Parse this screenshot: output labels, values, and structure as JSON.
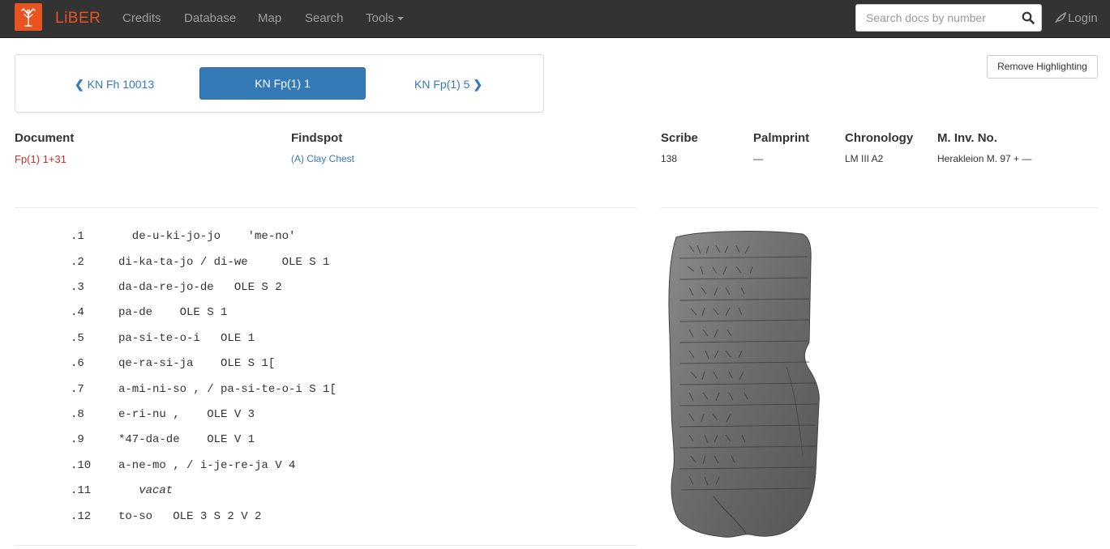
{
  "nav": {
    "brand": "LiBER",
    "items": [
      "Credits",
      "Database",
      "Map",
      "Search",
      "Tools"
    ],
    "search_placeholder": "Search docs by number",
    "login": "Login"
  },
  "pager": {
    "prev": "KN Fh 10013",
    "current": "KN Fp(1) 1",
    "next": "KN Fp(1) 5"
  },
  "remove_highlighting": "Remove Highlighting",
  "meta": {
    "document_label": "Document",
    "document_value": "Fp(1) 1+31",
    "findspot_label": "Findspot",
    "findspot_value": "(A) Clay Chest",
    "scribe_label": "Scribe",
    "scribe_value": "138",
    "palmprint_label": "Palmprint",
    "palmprint_value": "—",
    "chronology_label": "Chronology",
    "chronology_value": "LM III A2",
    "inv_label": "M. Inv. No.",
    "inv_value": "Herakleion M. 97 + —"
  },
  "lines": [
    {
      "num": ".1",
      "text": "  de-u-ki-jo-jo    'me-no'"
    },
    {
      "num": ".2",
      "text": "di-ka-ta-jo / di-we     OLE S 1"
    },
    {
      "num": ".3",
      "text": "da-da-re-jo-de   OLE S 2"
    },
    {
      "num": ".4",
      "text": "pa-de    OLE S 1"
    },
    {
      "num": ".5",
      "text": "pa-si-te-o-i   OLE 1"
    },
    {
      "num": ".6",
      "text": "qe-ra-si-ja    OLE S 1["
    },
    {
      "num": ".7",
      "text": "a-mi-ni-so , / pa-si-te-o-i S 1["
    },
    {
      "num": ".8",
      "text": "e-ri-nu ,    OLE V 3"
    },
    {
      "num": ".9",
      "text": "*47-da-de    OLE V 1"
    },
    {
      "num": ".10",
      "text": "a-ne-mo , / i-je-re-ja V 4"
    },
    {
      "num": ".11",
      "text": "   vacat"
    },
    {
      "num": ".12",
      "text": "to-so   OLE 3 S 2 V 2"
    }
  ],
  "colors": {
    "navbar": "#333333",
    "brand": "#e8541f",
    "link": "#337ab7",
    "document_value": "#c9302c"
  }
}
